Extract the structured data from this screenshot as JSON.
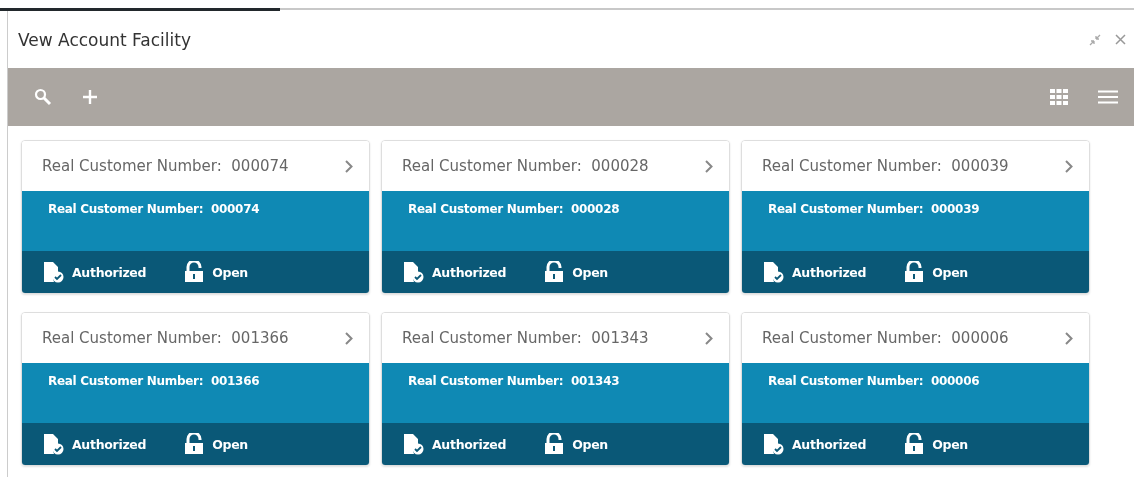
{
  "window": {
    "title": "Vew Account Facility"
  },
  "cards": [
    {
      "header": "Real Customer Number:  000074",
      "subtitle": "Real Customer Number:  000074",
      "authorization": "Authorized",
      "status": "Open"
    },
    {
      "header": "Real Customer Number:  000028",
      "subtitle": "Real Customer Number:  000028",
      "authorization": "Authorized",
      "status": "Open"
    },
    {
      "header": "Real Customer Number:  000039",
      "subtitle": "Real Customer Number:  000039",
      "authorization": "Authorized",
      "status": "Open"
    },
    {
      "header": "Real Customer Number:  001366",
      "subtitle": "Real Customer Number:  001366",
      "authorization": "Authorized",
      "status": "Open"
    },
    {
      "header": "Real Customer Number:  001343",
      "subtitle": "Real Customer Number:  001343",
      "authorization": "Authorized",
      "status": "Open"
    },
    {
      "header": "Real Customer Number:  000006",
      "subtitle": "Real Customer Number:  000006",
      "authorization": "Authorized",
      "status": "Open"
    }
  ]
}
